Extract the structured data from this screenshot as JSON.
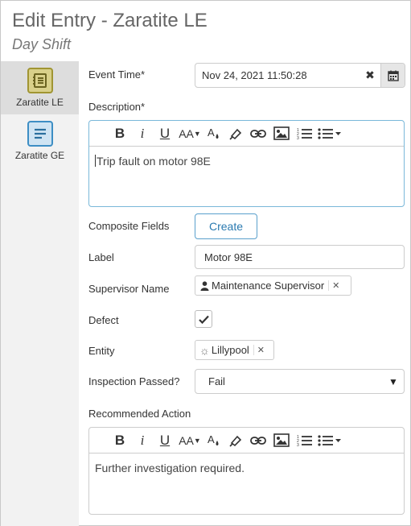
{
  "header": {
    "title": "Edit Entry - Zaratite LE",
    "subtitle": "Day Shift"
  },
  "sidebar": {
    "items": [
      {
        "label": "Zaratite LE",
        "icon": "logbook-icon",
        "color": "#a09532",
        "active": true
      },
      {
        "label": "Zaratite GE",
        "icon": "document-icon",
        "color": "#3d8ec4",
        "active": false
      }
    ]
  },
  "form": {
    "event_time": {
      "label": "Event Time*",
      "value": "Nov 24, 2021 11:50:28"
    },
    "description": {
      "label": "Description*",
      "value": "Trip fault on motor 98E"
    },
    "composite_fields": {
      "label": "Composite Fields",
      "button": "Create"
    },
    "label_field": {
      "label": "Label",
      "value": "Motor 98E"
    },
    "supervisor": {
      "label": "Supervisor Name",
      "value": "Maintenance Supervisor"
    },
    "defect": {
      "label": "Defect",
      "checked": true
    },
    "entity": {
      "label": "Entity",
      "value": "Lillypool"
    },
    "inspection": {
      "label": "Inspection Passed?",
      "value": "Fail"
    },
    "recommended_action": {
      "label": "Recommended Action",
      "value": "Further investigation required."
    }
  },
  "colors": {
    "accent": "#2a7ab0",
    "focus_border": "#7ab8d9"
  }
}
